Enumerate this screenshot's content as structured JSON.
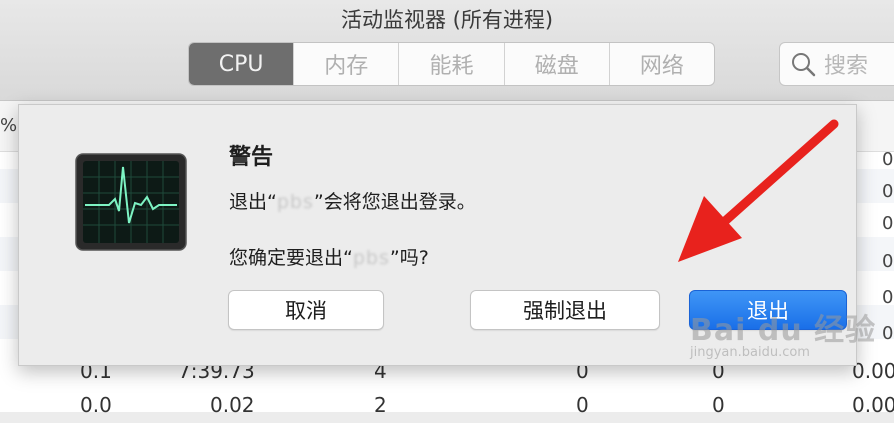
{
  "window": {
    "title": "活动监视器 (所有进程)"
  },
  "tabs": [
    {
      "label": "CPU",
      "active": true
    },
    {
      "label": "内存",
      "active": false
    },
    {
      "label": "能耗",
      "active": false
    },
    {
      "label": "磁盘",
      "active": false
    },
    {
      "label": "网络",
      "active": false
    }
  ],
  "search": {
    "placeholder": "搜索",
    "icon": "search-icon"
  },
  "table": {
    "partial_header": "%",
    "visible_rows": [
      [
        "0.1",
        "7:39.73",
        "4",
        "0",
        "0",
        "0.00"
      ],
      [
        "0.0",
        "0.02",
        "2",
        "0",
        "0",
        "0.00"
      ]
    ],
    "edge_values": [
      "0",
      "0",
      "0",
      "0",
      "0",
      "0"
    ]
  },
  "dialog": {
    "icon": "activity-monitor-icon",
    "title": "警告",
    "message_prefix": "退出“",
    "message_app": "pbs",
    "message_suffix": "”会将您退出登录。",
    "question_prefix": "您确定要退出“",
    "question_app": "pbs",
    "question_suffix": "”吗?",
    "buttons": {
      "cancel": "取消",
      "force_quit": "强制退出",
      "quit": "退出"
    }
  },
  "annotation": {
    "arrow_color": "#e8221d"
  },
  "watermark": {
    "main": "Bai du 经验",
    "sub": "jingyan.baidu.com"
  }
}
